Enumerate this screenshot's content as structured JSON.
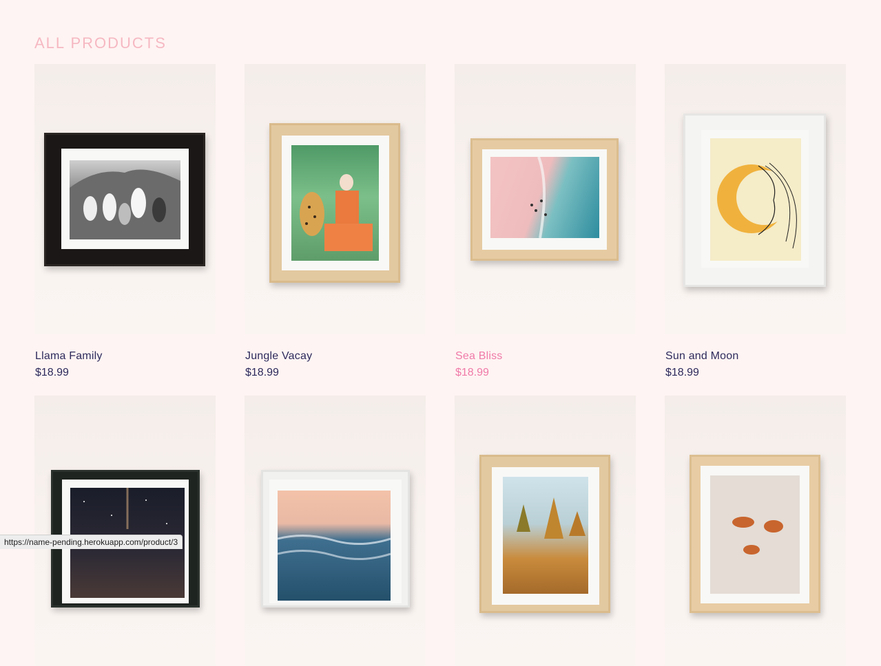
{
  "page": {
    "heading": "ALL PRODUCTS"
  },
  "products": [
    {
      "name": "Llama Family",
      "price": "$18.99"
    },
    {
      "name": "Jungle Vacay",
      "price": "$18.99"
    },
    {
      "name": "Sea Bliss",
      "price": "$18.99"
    },
    {
      "name": "Sun and Moon",
      "price": "$18.99"
    },
    {
      "name": "",
      "price": ""
    },
    {
      "name": "",
      "price": ""
    },
    {
      "name": "",
      "price": ""
    },
    {
      "name": "",
      "price": ""
    }
  ],
  "status_bar": {
    "url": "https://name-pending.herokuapp.com/product/3"
  },
  "colors": {
    "background": "#fef4f3",
    "heading": "#f6b8c2",
    "text": "#2d2a5c",
    "hover_accent": "#f07aa8"
  }
}
